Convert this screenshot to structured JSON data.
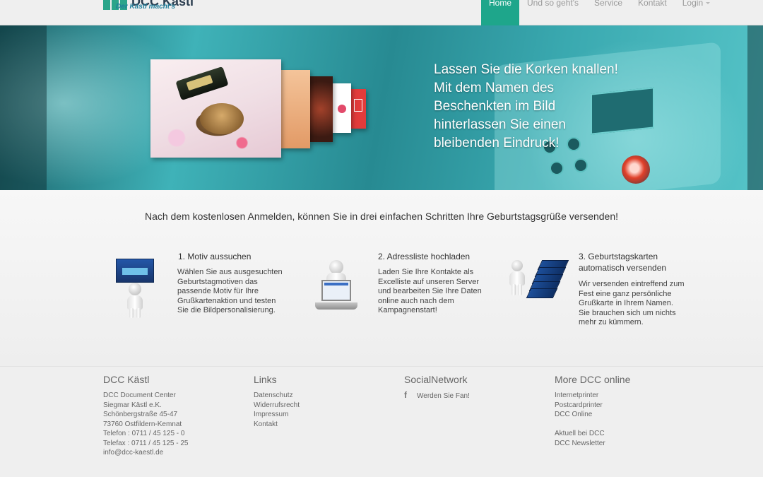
{
  "navbar": {
    "logo_name": "DCC Kästl",
    "logo_tagline": "Der Kästl macht's",
    "items": [
      {
        "label": "Home",
        "active": true
      },
      {
        "label": "Und so geht's"
      },
      {
        "label": "Service"
      },
      {
        "label": "Kontakt"
      },
      {
        "label": "Login"
      }
    ]
  },
  "hero": {
    "lines": [
      "Lassen Sie die Korken knallen!",
      "Mit dem Namen des",
      "Beschenkten im Bild",
      "hinterlassen Sie einen",
      "bleibenden Eindruck!"
    ]
  },
  "main": {
    "intro": "Nach dem kostenlosen Anmelden, können Sie in drei einfachen Schritten Ihre Geburtstagsgrüße versenden!",
    "steps": [
      {
        "title_lines": [
          "1. Motiv aussuchen"
        ],
        "text_lines": [
          "Wählen Sie aus ausgesuchten",
          "Geburtstagmotiven das",
          "passende Motiv für Ihre",
          "Grußkartenaktion und testen",
          "Sie die Bildpersonalisierung."
        ]
      },
      {
        "title_lines": [
          "2. Adressliste hochladen"
        ],
        "text_lines": [
          "Laden Sie Ihre Kontakte als",
          "Excelliste auf unseren Server",
          "und bearbeiten Sie Ihre Daten",
          "online auch nach dem",
          "Kampagnenstart!"
        ]
      },
      {
        "title_lines": [
          "3. Geburtstagskarten",
          "automatisch versenden"
        ],
        "text_lines": [
          "Wir versenden eintreffend zum",
          "Fest eine ganz persönliche",
          "Grußkarte in Ihrem Namen.",
          "Sie brauchen sich um nichts",
          "mehr zu kümmern."
        ]
      }
    ]
  },
  "footer": {
    "col1": {
      "heading": "DCC Kästl",
      "lines": [
        "DCC Document Center",
        "Siegmar Kästl e.K.",
        "Schönbergstraße 45-47",
        "73760 Ostfildern-Kemnat",
        "Telefon : 0711 / 45 125 - 0",
        "Telefax : 0711 / 45 125 - 25",
        "info@dcc-kaestl.de"
      ]
    },
    "col2": {
      "heading": "Links",
      "links": [
        "Datenschutz",
        "Widerrufsrecht",
        "Impressum",
        "Kontakt"
      ]
    },
    "col3": {
      "heading": "SocialNetwork",
      "facebook_icon": "facebook-icon",
      "fan_label": "Werden Sie Fan!"
    },
    "col4": {
      "heading": "More DCC online",
      "links_a": [
        "Internetprinter",
        "Postcardprinter",
        "DCC Online"
      ],
      "links_b": [
        "Aktuell bei DCC",
        "DCC Newsletter"
      ]
    }
  }
}
